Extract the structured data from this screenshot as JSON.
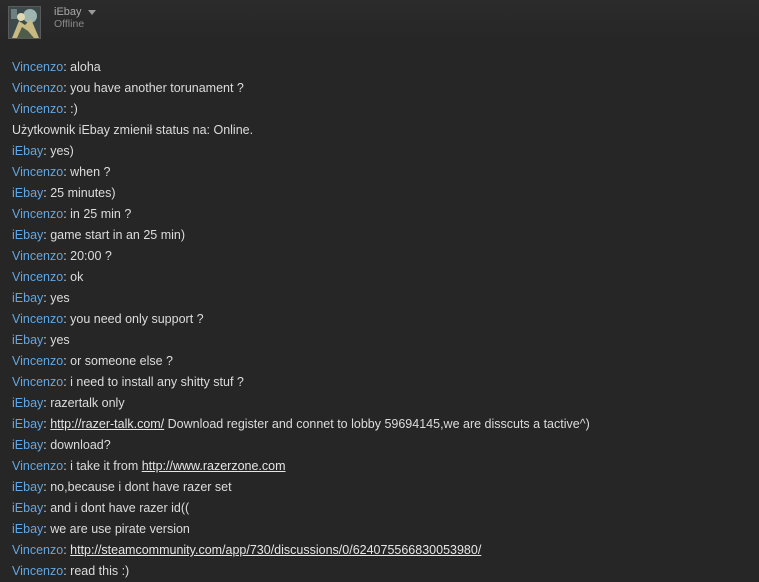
{
  "header": {
    "friend_name": "iEbay",
    "friend_status": "Offline"
  },
  "colors": {
    "background": "#262626",
    "sender_name": "#62a7e3",
    "message_text": "#dcdcdc"
  },
  "icons": {
    "avatar": "user-avatar",
    "dropdown": "chevron-down-icon"
  },
  "messages": [
    {
      "sender": "Vincenzo",
      "text": "aloha"
    },
    {
      "sender": "Vincenzo",
      "text": "you have another torunament ?"
    },
    {
      "sender": "Vincenzo",
      "text": ":)"
    },
    {
      "system": "Użytkownik iEbay zmienił status na: Online."
    },
    {
      "sender": "iEbay",
      "text": "yes)"
    },
    {
      "sender": "Vincenzo",
      "text": "when ?"
    },
    {
      "sender": "iEbay",
      "text": "25 minutes)"
    },
    {
      "sender": "Vincenzo",
      "text": "in 25 min ?"
    },
    {
      "sender": "iEbay",
      "text": "game start in an 25 min)"
    },
    {
      "sender": "Vincenzo",
      "text": "20:00 ?"
    },
    {
      "sender": "Vincenzo",
      "text": "ok"
    },
    {
      "sender": "iEbay",
      "text": "yes"
    },
    {
      "sender": "Vincenzo",
      "text": "you need only support ?"
    },
    {
      "sender": "iEbay",
      "text": "yes"
    },
    {
      "sender": "Vincenzo",
      "text": "or someone else ?"
    },
    {
      "sender": "Vincenzo",
      "text": "i need to install any shitty stuf ?"
    },
    {
      "sender": "iEbay",
      "text": "razertalk only"
    },
    {
      "sender": "iEbay",
      "link": "http://razer-talk.com/",
      "after": " Download register and connet to lobby 59694145,we are disscuts a tactive^)"
    },
    {
      "sender": "iEbay",
      "text": "download?"
    },
    {
      "sender": "Vincenzo",
      "text": "i take it from ",
      "link": "http://www.razerzone.com"
    },
    {
      "sender": "iEbay",
      "text": "no,because i dont have razer set"
    },
    {
      "sender": "iEbay",
      "text": "and i dont have razer id(("
    },
    {
      "sender": "iEbay",
      "text": "we are use pirate version"
    },
    {
      "sender": "Vincenzo",
      "link": "http://steamcommunity.com/app/730/discussions/0/624075566830053980/"
    },
    {
      "sender": "Vincenzo",
      "text": "read this :)"
    }
  ]
}
